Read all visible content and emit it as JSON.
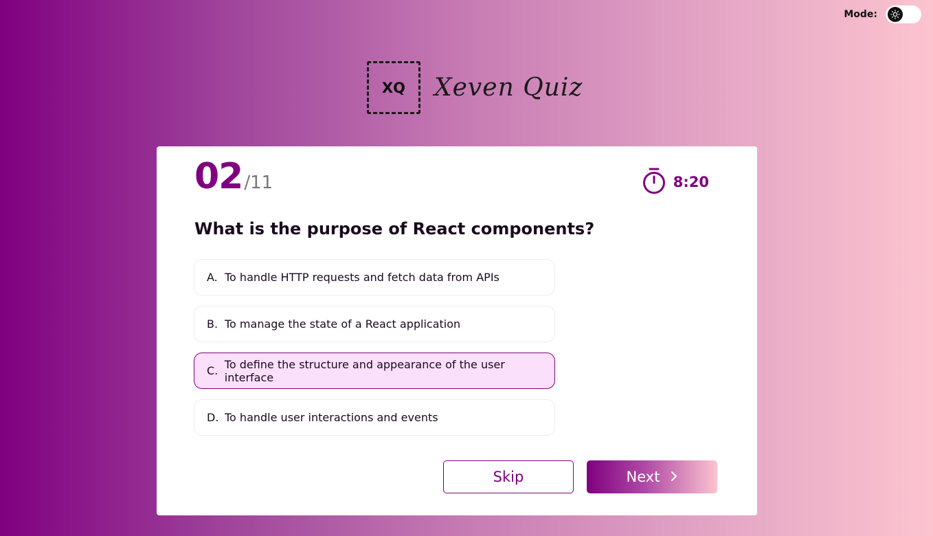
{
  "colors": {
    "brand": "#800080",
    "selected_bg": "#fbe0fb",
    "gradient_end": "#fcc4cf"
  },
  "mode": {
    "label": "Mode:",
    "toggle_icon": "sun-icon"
  },
  "logo": {
    "mark": "XQ",
    "name": "Xeven Quiz"
  },
  "quiz": {
    "current": "02",
    "total": "/11",
    "timer": "8:20",
    "question": "What is the purpose of React components?",
    "options": [
      {
        "letter": "A.",
        "text": "To handle HTTP requests and fetch data from APIs"
      },
      {
        "letter": "B.",
        "text": "To manage the state of a React application"
      },
      {
        "letter": "C.",
        "text": "To define the structure and appearance of the user interface"
      },
      {
        "letter": "D.",
        "text": "To handle user interactions and events"
      }
    ],
    "selected_option": "C."
  },
  "actions": {
    "skip": "Skip",
    "next": "Next"
  }
}
